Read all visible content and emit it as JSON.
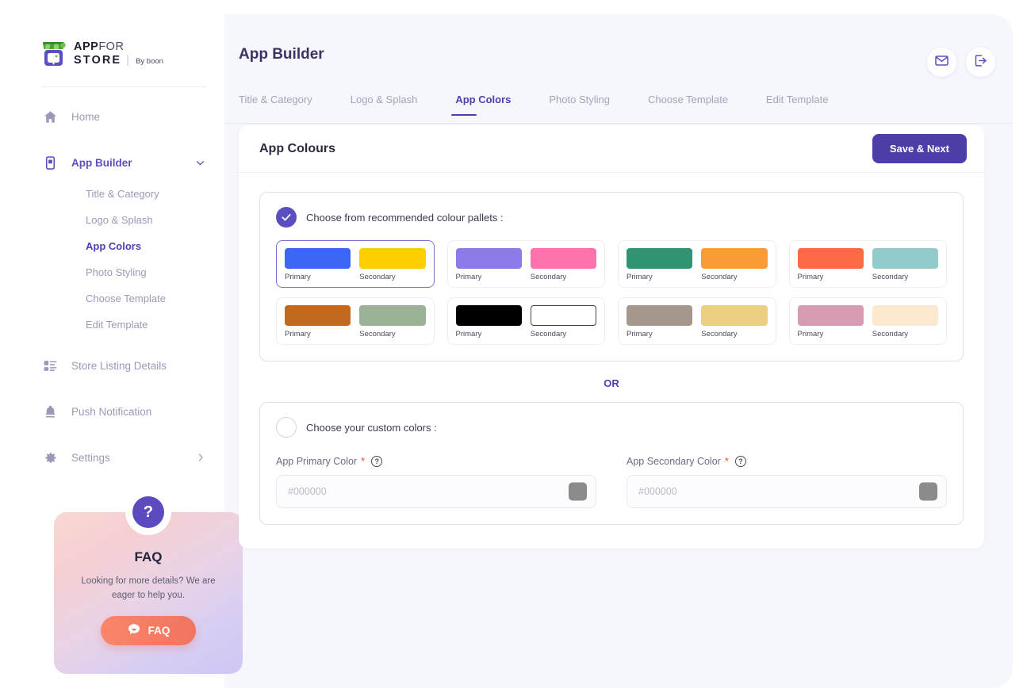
{
  "brand": {
    "line1_bold": "APP",
    "line1_light": "FOR",
    "line2": "STORE",
    "separator": "|",
    "byline": "By boon"
  },
  "sidebar": {
    "items": [
      {
        "label": "Home",
        "icon": "home-icon",
        "active": false
      },
      {
        "label": "App Builder",
        "icon": "app-builder-icon",
        "active": true,
        "expandable": true
      },
      {
        "label": "Store Listing Details",
        "icon": "list-details-icon",
        "active": false
      },
      {
        "label": "Push Notification",
        "icon": "bell-icon",
        "active": false
      },
      {
        "label": "Settings",
        "icon": "gear-icon",
        "active": false,
        "chevron": "right"
      }
    ],
    "subitems": [
      {
        "label": "Title & Category",
        "active": false
      },
      {
        "label": "Logo & Splash",
        "active": false
      },
      {
        "label": "App Colors",
        "active": true
      },
      {
        "label": "Photo Styling",
        "active": false
      },
      {
        "label": "Choose Template",
        "active": false
      },
      {
        "label": "Edit Template",
        "active": false
      }
    ]
  },
  "faq": {
    "badge": "?",
    "title": "FAQ",
    "description": "Looking for more details? We are eager to help you.",
    "button_label": "FAQ"
  },
  "header": {
    "title": "App Builder",
    "mail_icon": "mail-icon",
    "logout_icon": "logout-icon"
  },
  "tabs": [
    {
      "label": "Title & Category",
      "active": false
    },
    {
      "label": "Logo & Splash",
      "active": false
    },
    {
      "label": "App Colors",
      "active": true
    },
    {
      "label": "Photo Styling",
      "active": false
    },
    {
      "label": "Choose Template",
      "active": false
    },
    {
      "label": "Edit Template",
      "active": false
    }
  ],
  "card": {
    "title": "App Colours",
    "save_label": "Save & Next"
  },
  "recommended": {
    "label": "Choose from recommended colour pallets :",
    "selected_index": 0,
    "primary_caption": "Primary",
    "secondary_caption": "Secondary",
    "pallets": [
      {
        "primary": "#3b66f5",
        "secondary": "#fdcf00",
        "selected": true
      },
      {
        "primary": "#8b7ae8",
        "secondary": "#fc74ab",
        "selected": false
      },
      {
        "primary": "#2f9471",
        "secondary": "#fb9b37",
        "selected": false
      },
      {
        "primary": "#fb6a45",
        "secondary": "#92ccca",
        "selected": false
      },
      {
        "primary": "#c1691f",
        "secondary": "#9bb294",
        "selected": false
      },
      {
        "primary": "#000000",
        "secondary": "#ffffff",
        "secondary_outlined": true,
        "selected": false
      },
      {
        "primary": "#a6978c",
        "secondary": "#ebcf84",
        "selected": false
      },
      {
        "primary": "#d79bb4",
        "secondary": "#fbe8cf",
        "selected": false
      }
    ]
  },
  "divider": {
    "or": "OR"
  },
  "custom": {
    "label": "Choose your custom colors :",
    "primary": {
      "label": "App Primary Color",
      "required": "*",
      "help": "?",
      "value": "",
      "placeholder": "#000000",
      "chip_color": "#8b8b8b"
    },
    "secondary": {
      "label": "App Secondary Color",
      "required": "*",
      "help": "?",
      "value": "",
      "placeholder": "#000000",
      "chip_color": "#8b8b8b"
    }
  },
  "colors": {
    "accent": "#4c3fb5",
    "accent_button": "#4b3fa7",
    "muted_text": "#9a9ab8",
    "page_bg": "#f6f6fd"
  }
}
